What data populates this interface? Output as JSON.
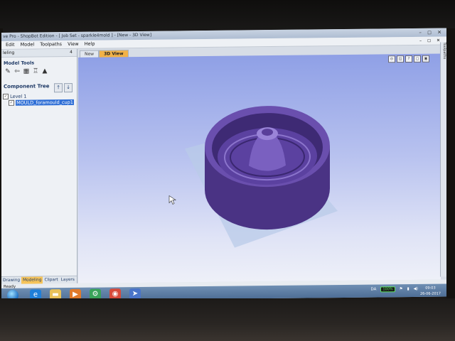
{
  "window": {
    "title": "ve Pro - ShopBot Edition - [ Job Set - sparkle4mold ] - [New - 3D View]",
    "controls": "– ◻ ✕"
  },
  "menu": {
    "items": [
      "Edit",
      "Model",
      "Toolpaths",
      "View",
      "Help"
    ],
    "right_controls": "– ◻ ✕"
  },
  "left_panel": {
    "header": "leling",
    "pin": "4",
    "model_tools_title": "Model Tools",
    "tools": [
      "✎",
      "⇦",
      "▦",
      "♖",
      "▲"
    ],
    "component_tree_title": "Component Tree",
    "tree_up": "↑",
    "tree_down": "↓",
    "level_label": "Level 1",
    "component_label": "MOULD_foramould_cup1",
    "tabs": [
      "Drawing",
      "Modeling",
      "Clipart",
      "Layers"
    ],
    "active_tab": "Modeling"
  },
  "view_tabs": {
    "tabs": [
      "New",
      "3D View"
    ],
    "active": "3D View"
  },
  "view_icons": [
    "⊙",
    "◫",
    "?",
    "▢",
    "▣"
  ],
  "right_strip": "Toolpaths",
  "status": {
    "text": "Ready"
  },
  "taskbar": {
    "icons": [
      {
        "name": "ie-icon",
        "glyph": "e",
        "color": "#1f7fd8"
      },
      {
        "name": "folder-icon",
        "glyph": "▬",
        "color": "#e8c25a"
      },
      {
        "name": "media-player-icon",
        "glyph": "▶",
        "color": "#e07a2a"
      },
      {
        "name": "app-icon",
        "glyph": "⚙",
        "color": "#3aa35a"
      },
      {
        "name": "chrome-icon",
        "glyph": "◉",
        "color": "#d84a3a"
      },
      {
        "name": "vectric-icon",
        "glyph": "➤",
        "color": "#4a74c8"
      }
    ],
    "language": "DA",
    "battery": "100%",
    "time": "09:03",
    "date": "26-06-2017"
  },
  "colors": {
    "model_purple": "#5a3f9a",
    "viewport_top": "#8fa0e6",
    "accent_tab": "#f2b248"
  }
}
